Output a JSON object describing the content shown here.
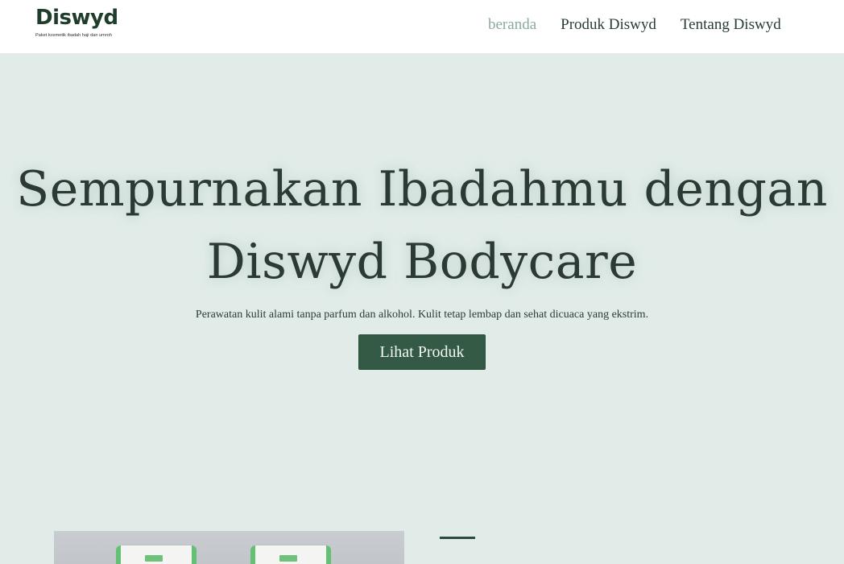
{
  "header": {
    "brand_name": "Diswyd",
    "brand_tagline": "Paket kosmetik ibadah haji dan umroh",
    "nav": [
      {
        "label": "beranda",
        "active": true
      },
      {
        "label": "Produk Diswyd",
        "active": false
      },
      {
        "label": "Tentang Diswyd",
        "active": false
      }
    ]
  },
  "hero": {
    "title_line1": "Sempurnakan Ibadahmu dengan",
    "title_line2": "Diswyd Bodycare",
    "subtitle": "Perawatan kulit alami tanpa parfum dan alkohol. Kulit tetap lembap dan sehat dicuaca yang ekstrim.",
    "cta_label": "Lihat Produk"
  },
  "colors": {
    "brand": "#1f3d2b",
    "hero_background": "#e1ece8",
    "accent_button": "#345a45",
    "nav_active": "#8aaa9d"
  }
}
